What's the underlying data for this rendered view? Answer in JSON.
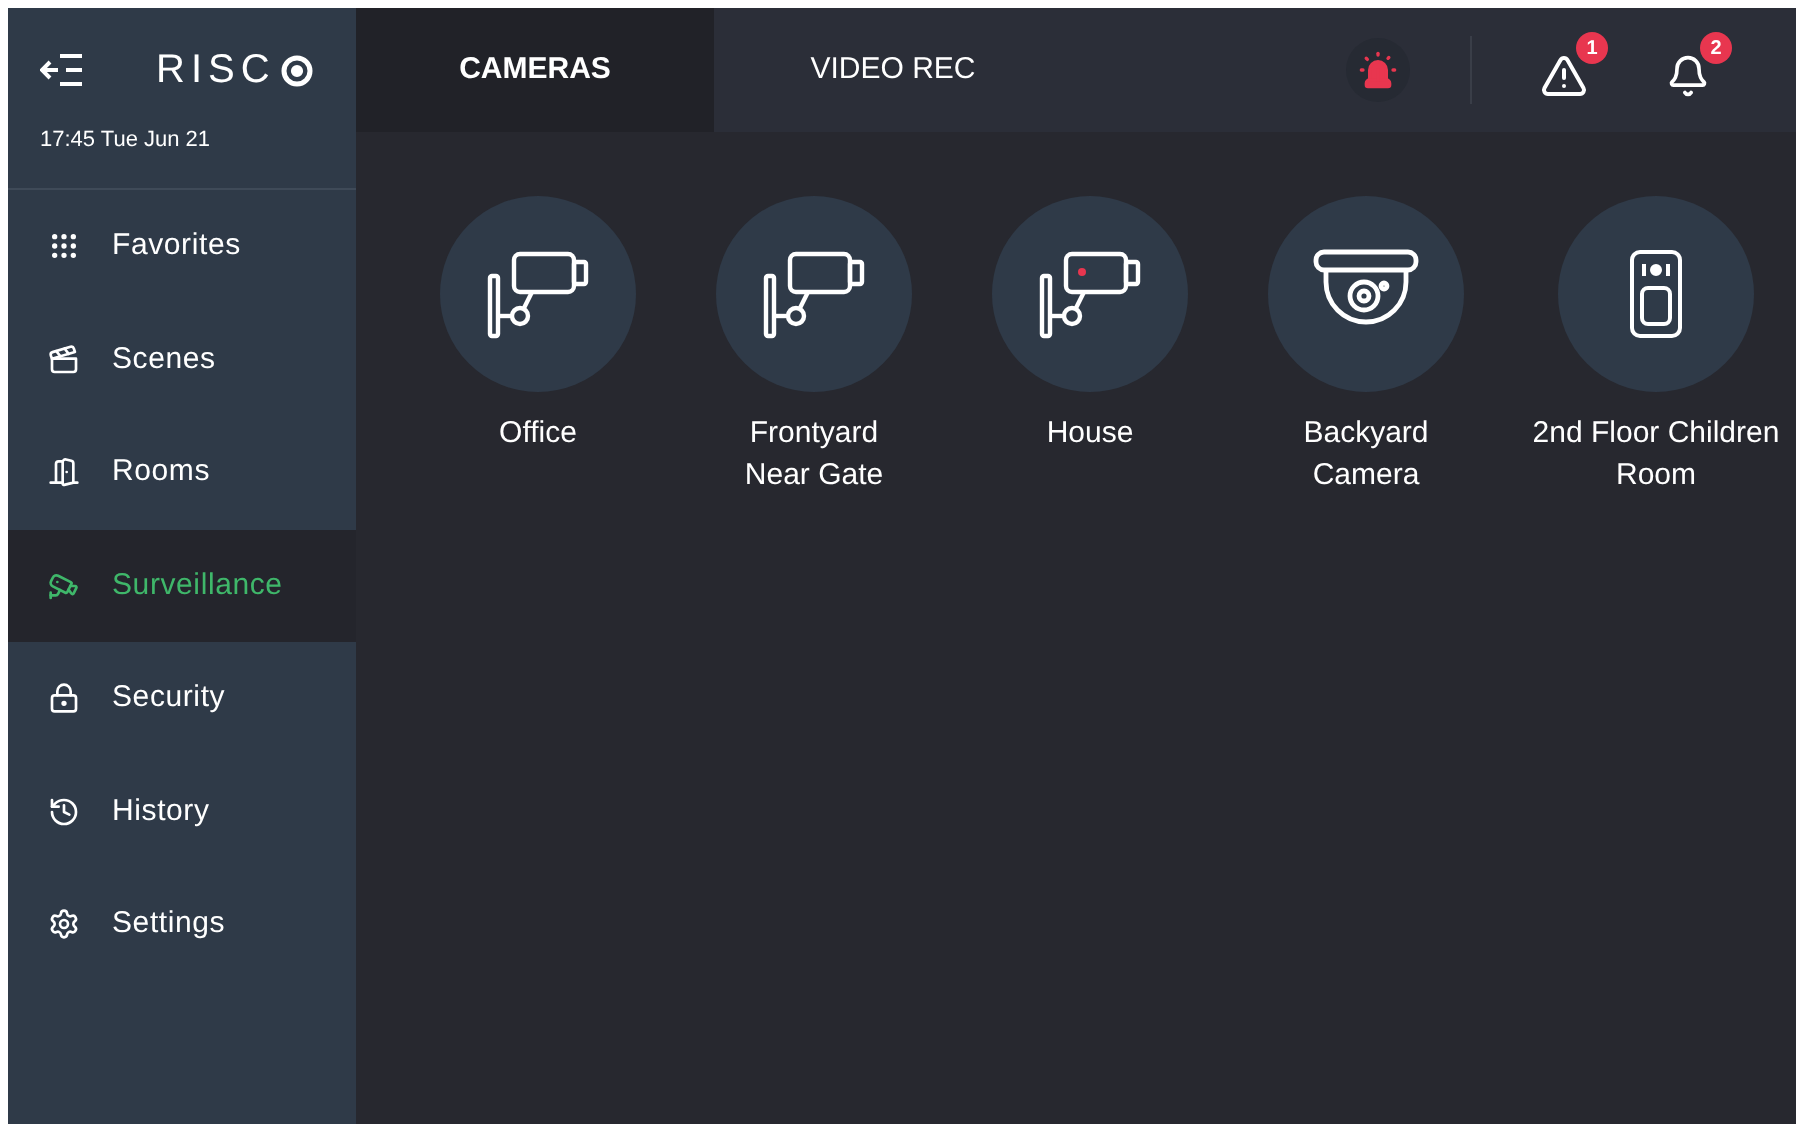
{
  "header": {
    "logo": "RISC",
    "datetime": "17:45 Tue Jun 21"
  },
  "sidebar": {
    "items": [
      {
        "label": "Favorites",
        "selected": false
      },
      {
        "label": "Scenes",
        "selected": false
      },
      {
        "label": "Rooms",
        "selected": false
      },
      {
        "label": "Surveillance",
        "selected": true
      },
      {
        "label": "Security",
        "selected": false
      },
      {
        "label": "History",
        "selected": false
      },
      {
        "label": "Settings",
        "selected": false
      }
    ]
  },
  "tabs": [
    {
      "label": "CAMERAS",
      "selected": true
    },
    {
      "label": "VIDEO REC",
      "selected": false
    }
  ],
  "alerts": {
    "siren_active": true,
    "trouble_count": "1",
    "notification_count": "2"
  },
  "cameras": [
    {
      "name": "Office",
      "kind": "bullet"
    },
    {
      "name": "Frontyard Near Gate",
      "kind": "bullet"
    },
    {
      "name": "House",
      "kind": "recording-bullet"
    },
    {
      "name": "Backyard Camera",
      "kind": "dome"
    },
    {
      "name": "2nd Floor Children Room",
      "kind": "sensor"
    }
  ]
}
